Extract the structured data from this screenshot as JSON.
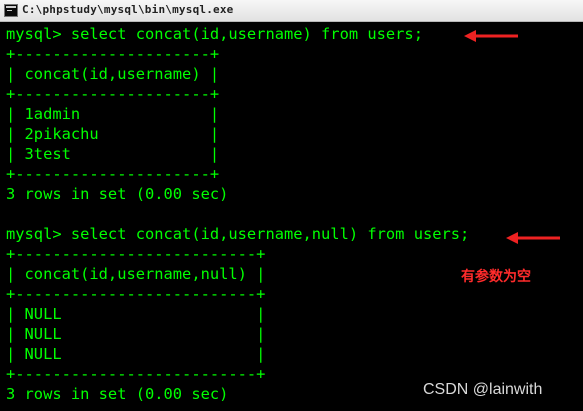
{
  "window": {
    "title": "C:\\phpstudy\\mysql\\bin\\mysql.exe",
    "icon": "console-window-icon"
  },
  "console": {
    "text_color": "#00ff00",
    "background": "#000000",
    "lines": [
      "mysql> select concat(id,username) from users;",
      "+---------------------+",
      "| concat(id,username) |",
      "+---------------------+",
      "| 1admin              |",
      "| 2pikachu            |",
      "| 3test               |",
      "+---------------------+",
      "3 rows in set (0.00 sec)",
      "",
      "mysql> select concat(id,username,null) from users;",
      "+--------------------------+",
      "| concat(id,username,null) |",
      "+--------------------------+",
      "| NULL                     |",
      "| NULL                     |",
      "| NULL                     |",
      "+--------------------------+",
      "3 rows in set (0.00 sec)"
    ]
  },
  "annotations": {
    "arrow_color": "#ee2222",
    "note_text": "有参数为空",
    "note_color": "#ff2b2b"
  },
  "watermark": {
    "text": "CSDN @lainwith"
  }
}
